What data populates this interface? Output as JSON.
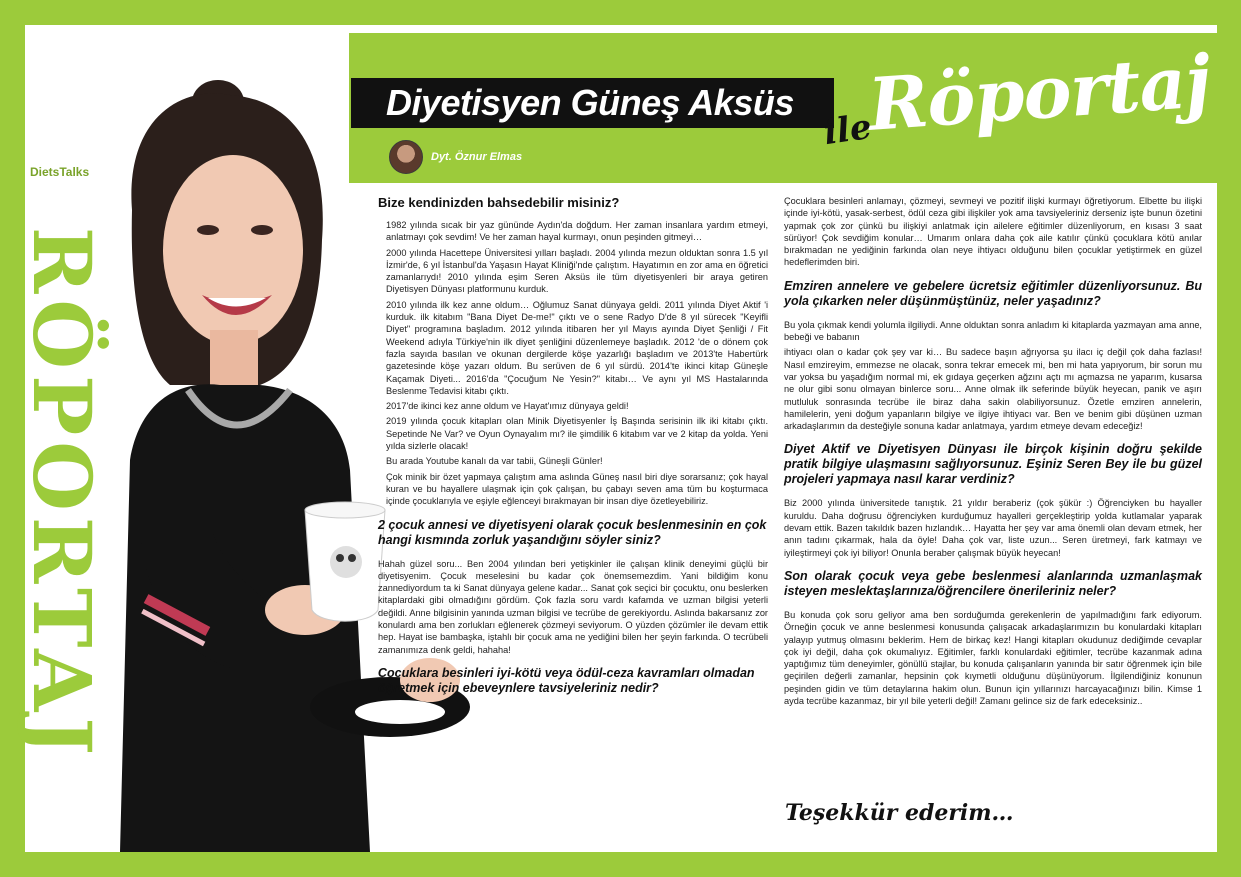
{
  "header": {
    "title": "Diyetisyen Güneş Aksüs",
    "script_ile": "ile",
    "script_roportaj": "Röportaj",
    "author": "Dyt. Öznur Elmas"
  },
  "sidebar": {
    "vertical_title": "RÖPORTAJ",
    "brand": "DietsTalks"
  },
  "col1": {
    "q1": "Bize kendinizden bahsedebilir misiniz?",
    "a1": [
      "1982 yılında sıcak bir yaz gününde Aydın'da doğdum. Her zaman insanlara yardım etmeyi, anlatmayı çok sevdim! Ve her zaman hayal kurmayı, onun peşinden gitmeyi…",
      "2000 yılında Hacettepe Üniversitesi yılları başladı. 2004 yılında mezun olduktan sonra 1.5 yıl İzmir'de, 6 yıl İstanbul'da Yaşasın Hayat Kliniği'nde çalıştım. Hayatımın en zor ama en öğretici zamanlarıydı! 2010 yılında eşim Seren Aksüs ile tüm diyetisyenleri bir araya getiren Diyetisyen Dünyası platformunu kurduk.",
      "2010 yılında ilk kez anne oldum… Oğlumuz Sanat dünyaya geldi. 2011 yılında Diyet Aktif 'i kurduk. ilk kitabım \"Bana Diyet De-me!\" çıktı ve o sene Radyo D'de 8 yıl sürecek \"Keyifli Diyet\" programına başladım. 2012 yılında itibaren her yıl Mayıs ayında Diyet Şenliği / Fit Weekend adıyla Türkiye'nin ilk diyet şenliğini düzenlemeye başladık. 2012 'de o dönem çok fazla sayıda basılan ve okunan dergilerde köşe yazarlığı başladım ve 2013'te Habertürk gazetesinde köşe yazarı oldum. Bu serüven de 6 yıl sürdü. 2014'te ikinci kitap Güneşle Kaçamak Diyeti... 2016'da \"Çocuğum Ne Yesin?\" kitabı… Ve aynı yıl MS Hastalarında Beslenme Tedavisi kitabı çıktı.",
      "2017'de ikinci kez anne oldum ve Hayat'ımız dünyaya geldi!",
      "2019 yılında çocuk kitapları olan Minik Diyetisyenler İş Başında serisinin ilk iki kitabı çıktı. Sepetinde Ne Var? ve Oyun Oynayalım mı? ile şimdilik 6 kitabım var ve 2 kitap da yolda. Yeni yılda sizlerle olacak!",
      "Bu arada Youtube kanalı da var tabii, Güneşli Günler!",
      "Çok minik bir özet yapmaya çalıştım ama aslında Güneş nasıl biri diye sorarsanız; çok hayal kuran ve bu hayallere ulaşmak için çok çalışan, bu çabayı seven ama tüm bu koşturmaca içinde çocuklarıyla ve eşiyle eğlenceyi bırakmayan bir insan diye özetleyebiliriz."
    ],
    "q2": "2 çocuk annesi ve diyetisyeni olarak çocuk beslenmesinin en çok hangi kısmında zorluk yaşandığını söyler siniz?",
    "a2": "Hahah güzel soru... Ben 2004 yılından beri yetişkinler ile çalışan klinik deneyimi güçlü bir diyetisyenim. Çocuk meselesini bu kadar çok önemsemezdim. Yani bildiğim konu zannediyordum ta ki Sanat dünyaya gelene kadar... Sanat çok seçici bir çocuktu, onu beslerken kitaplardaki gibi olmadığını gördüm. Çok fazla soru vardı kafamda ve uzman bilgisi yeterli değildi. Anne bilgisinin yanında uzman bilgisi ve tecrübe de gerekiyordu. Aslında bakarsanız zor konulardı ama ben zorlukları eğlenerek çözmeyi seviyorum. O yüzden çözümler ile devam ettik hep. Hayat ise bambaşka, iştahlı bir çocuk ama ne yediğini bilen her şeyin farkında. O tecrübeli zamanımıza denk geldi, hahaha!",
    "q3": "Çocuklara besinleri iyi-kötü veya ödül-ceza kavramları olmadan öğretmek için ebeveynlere tavsiyeleriniz nedir?"
  },
  "col2": {
    "a3": "Çocuklara besinleri anlamayı, çözmeyi, sevmeyi ve pozitif ilişki kurmayı öğretiyorum. Elbette bu ilişki içinde iyi-kötü, yasak-serbest, ödül ceza gibi ilişkiler yok ama tavsiyeleriniz derseniz işte bunun özetini yapmak çok zor çünkü bu ilişkiyi anlatmak için ailelere eğitimler düzenliyorum, en kısası 3 saat sürüyor! Çok sevdiğim konular… Umarım onlara daha çok aile katılır çünkü çocuklara kötü anılar bırakmadan ne yediğinin farkında olan neye ihtiyacı olduğunu bilen çocuklar yetiştirmek en güzel hedeflerimden biri.",
    "q4": "Emziren annelere ve gebelere ücretsiz eğitimler düzenliyorsunuz. Bu yola çıkarken neler düşünmüştünüz, neler yaşadınız?",
    "a4_p1": "Bu yola çıkmak kendi yolumla ilgiliydi. Anne olduktan sonra anladım ki kitaplarda yazmayan ama anne, bebeği ve babanın",
    "a4_p2": "ihtiyacı olan o kadar çok şey var ki… Bu sadece başın ağrıyorsa şu ilacı iç değil çok daha fazlası! Nasıl emzireyim, emmezse ne olacak, sonra tekrar emecek mi, ben mi hata yapıyorum, bir sorun mu var yoksa bu yaşadığım normal mi, ek gıdaya geçerken ağzını açtı mı açmazsa ne yaparım, kusarsa ne olur gibi sonu olmayan binlerce soru... Anne olmak ilk seferinde büyük heyecan, panik ve aşırı mutluluk sonrasında tecrübe ile biraz daha sakin olabiliyorsunuz. Özetle emziren annelerin, hamilelerin, yeni doğum yapanların bilgiye ve ilgiye ihtiyacı var. Ben ve benim gibi düşünen uzman arkadaşlarımın da desteğiyle sonuna kadar anlatmaya, yardım etmeye devam edeceğiz!",
    "q5": "Diyet Aktif ve Diyetisyen Dünyası ile birçok kişinin doğru şekilde pratik bilgiye ulaşmasını sağlıyorsunuz. Eşiniz Seren Bey ile bu güzel projeleri yapmaya nasıl karar verdiniz?",
    "a5": "Biz 2000 yılında üniversitede tanıştık. 21 yıldır beraberiz (çok şükür :) Öğrenciyken bu hayaller kuruldu. Daha doğrusu öğrenciyken kurduğumuz hayalleri gerçekleştirip yolda kutlamalar yaparak devam ettik. Bazen takıldık bazen hızlandık… Hayatta her şey var ama önemli olan devam etmek, her anın tadını çıkarmak, hala da öyle! Daha çok var, liste uzun... Seren üretmeyi, fark katmayı ve iyileştirmeyi çok iyi biliyor! Onunla beraber çalışmak büyük heyecan!",
    "q6": "Son olarak çocuk veya gebe beslenmesi alanlarında uzmanlaşmak isteyen meslektaşlarınıza/öğrencilere önerileriniz neler?",
    "a6": "Bu konuda çok soru geliyor ama ben sorduğumda gerekenlerin de yapılmadığını fark ediyorum. Örneğin çocuk ve anne beslenmesi konusunda çalışacak arkadaşlarımızın bu konulardaki kitapları yalayıp yutmuş olmasını beklerim. Hem de birkaç kez! Hangi kitapları okudunuz dediğimde cevaplar çok iyi değil, daha çok okumalıyız. Eğitimler, farklı konulardaki eğitimler, tecrübe kazanmak adına yaptığımız tüm deneyimler, gönüllü stajlar, bu konuda çalışanların yanında bir satır öğrenmek için bile geçirilen değerli zamanlar, hepsinin çok kıymetli olduğunu düşünüyorum. İlgilendiğiniz konunun peşinden gidin ve tüm detaylarına hakim olun. Bunun için yıllarınızı harcayacağınızı bilin. Kimse 1 ayda tecrübe kazanmaz, bir yıl bile yeterli değil! Zamanı gelince siz de fark edeceksiniz..",
    "thanks": "Teşekkür ederim…"
  },
  "colors": {
    "accent": "#9ccb3b",
    "dark": "#111111"
  }
}
